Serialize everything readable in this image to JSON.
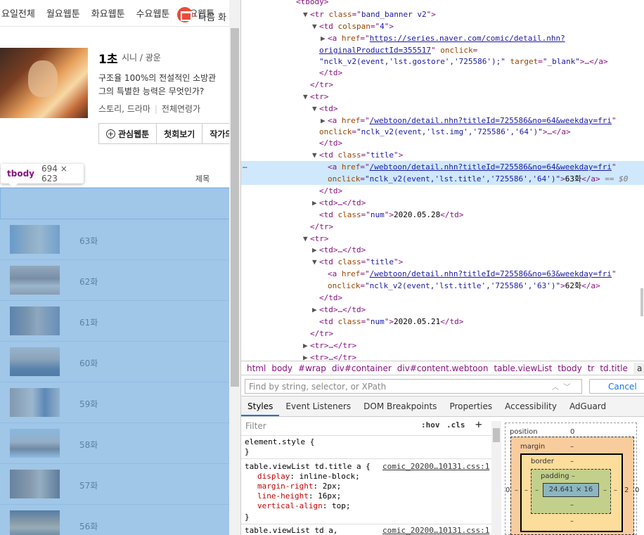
{
  "webpage": {
    "day_tabs": [
      "요일전체",
      "월요웹툰",
      "화요웹툰",
      "수요웹툰",
      "목요웹툰"
    ],
    "comic": {
      "title": "1초",
      "author": "시니 / 광운",
      "description_line1": "구조율 100%의 전설적인 소방관",
      "description_line2": "그의 특별한 능력은 무엇인가?",
      "genre": "스토리, 드라마",
      "age": "전체연령가"
    },
    "buttons": {
      "favorite": "관심웹툰",
      "first_episode": "첫회보기",
      "author_other": "작가의"
    },
    "list_header": {
      "title_col": "제목"
    },
    "tooltip": {
      "tag": "tbody",
      "size": "694 × 623"
    },
    "banner": {
      "text": "다음 화"
    },
    "episodes": [
      "63화",
      "62화",
      "61화",
      "60화",
      "59화",
      "58화",
      "57화",
      "56화"
    ],
    "colors": {
      "overlay": "#6fa8dc",
      "banner_icon": "#e74c3c"
    }
  },
  "devtools": {
    "dom": {
      "l0": "<tbody>",
      "l1_tag": "tr",
      "l1_attr": "class",
      "l1_val": "band_banner v2",
      "l2_tag": "td",
      "l2_attr": "colspan",
      "l2_val": "4",
      "l3_tag": "a",
      "l3_attr": "href",
      "l3_val": "https://series.naver.com/comic/detail.nhn?",
      "l4_val": "originalProductId=355517",
      "l4_attr": "onclick",
      "l5_val": "nclk_v2(event,'lst.gostore','725586');",
      "l5_attr": "target",
      "l5_val2": "_blank",
      "l6": "</td>",
      "l7": "</tr>",
      "l8": "<tr>",
      "l9": "<td>",
      "l10_attr": "href",
      "l10_val": "/webtoon/detail.nhn?titleId=725586&no=64&weekday=fri",
      "l11_attr": "onclick",
      "l11_val": "nclk_v2(event,'lst.img','725586','64')",
      "l12": "</td>",
      "l13_attr": "class",
      "l13_val": "title",
      "l14_attr": "href",
      "l14_val": "/webtoon/detail.nhn?titleId=725586&no=64&weekday=fri",
      "l15_attr": "onclick",
      "l15_val": "nclk_v2(event,'lst.title','725586','64')",
      "l15_text": "63화",
      "l15_eq": "== $0",
      "l16": "</td>",
      "l17": "<td>…</td>",
      "l18_attr": "class",
      "l18_val": "num",
      "l18_text": "2020.05.28",
      "l19": "</tr>",
      "l20": "<tr>",
      "l21": "<td>…</td>",
      "l22_attr": "class",
      "l22_val": "title",
      "l23_attr": "href",
      "l23_val": "/webtoon/detail.nhn?titleId=725586&no=63&weekday=fri",
      "l24_attr": "onclick",
      "l24_val": "nclk_v2(event,'lst.title','725586','63')",
      "l24_text": "62화",
      "l25": "</td>",
      "l26": "<td>…</td>",
      "l27_attr": "class",
      "l27_val": "num",
      "l27_text": "2020.05.21",
      "l28": "</tr>",
      "l29": "<tr>…</tr>",
      "l30": "<tr>…</tr>",
      "dots": "…"
    },
    "breadcrumbs": [
      "html",
      "body",
      "#wrap",
      "div#container",
      "div#content.webtoon",
      "table.viewList",
      "tbody",
      "tr",
      "td.title",
      "a"
    ],
    "search": {
      "placeholder": "Find by string, selector, or XPath",
      "cancel": "Cancel"
    },
    "tabs": [
      "Styles",
      "Event Listeners",
      "DOM Breakpoints",
      "Properties",
      "Accessibility",
      "AdGuard"
    ],
    "styles": {
      "filter_placeholder": "Filter",
      "hov": ":hov",
      "cls": ".cls",
      "plus": "+",
      "element_style": "element.style {",
      "close": "}",
      "rule1_selector": "table.viewList td.title a {",
      "rule1_source": "comic_20200…10131.css:1",
      "rule1_props": [
        {
          "name": "display",
          "value": "inline-block;"
        },
        {
          "name": "margin-right",
          "value": "2px;"
        },
        {
          "name": "line-height",
          "value": "16px;"
        },
        {
          "name": "vertical-align",
          "value": "top;"
        }
      ],
      "rule2_selector": "table.viewList td a,",
      "rule2_source": "comic_20200…10131.css:1"
    },
    "box_model": {
      "position_label": "position",
      "position_value": "0",
      "margin_label": "margin",
      "margin_value": "–",
      "border_label": "border",
      "border_value": "–",
      "padding_label": "padding –",
      "content": "24.641 × 16",
      "left_outer": "0",
      "right_outer": "0",
      "right_margin": "2",
      "dash": "–"
    }
  }
}
